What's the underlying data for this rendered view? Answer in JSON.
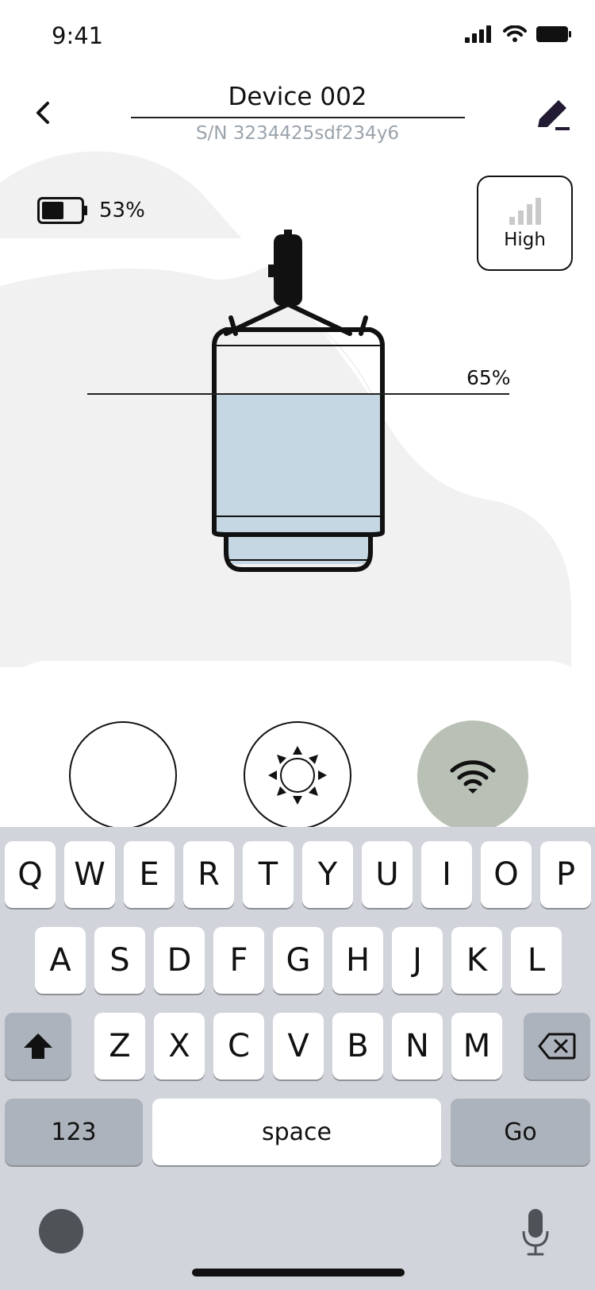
{
  "status_bar": {
    "time": "9:41"
  },
  "header": {
    "title": "Device 002",
    "serial": "S/N 3234425sdf234y6"
  },
  "battery": {
    "percent_text": "53%",
    "level": 0.53
  },
  "signal": {
    "label": "High"
  },
  "tank": {
    "fill_level_text": "65%",
    "fill_level": 0.65
  },
  "colors": {
    "tank_fill": "#c5d7e3",
    "wifi_button_bg": "#b9c0b5",
    "keyboard_bg": "#d1d4db",
    "function_key_bg": "#adb3bc"
  },
  "keyboard": {
    "row1": [
      "Q",
      "W",
      "E",
      "R",
      "T",
      "Y",
      "U",
      "I",
      "O",
      "P"
    ],
    "row2": [
      "A",
      "S",
      "D",
      "F",
      "G",
      "H",
      "J",
      "K",
      "L"
    ],
    "row3": [
      "Z",
      "X",
      "C",
      "V",
      "B",
      "N",
      "M"
    ],
    "numbers_label": "123",
    "space_label": "space",
    "go_label": "Go"
  }
}
